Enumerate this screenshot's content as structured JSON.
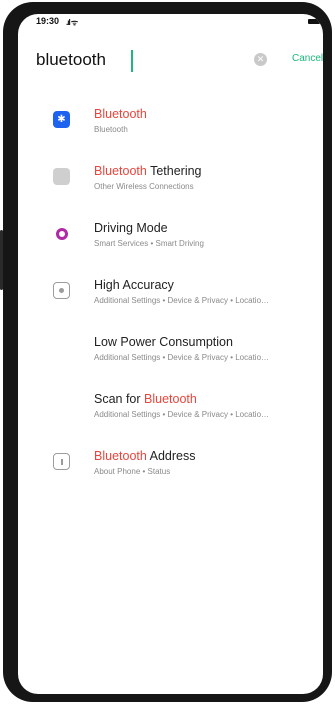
{
  "status_bar": {
    "time": "19:30",
    "signal": ".ıl ᯤ"
  },
  "search": {
    "value": "bluetooth",
    "clear_glyph": "✕",
    "cancel_label": "Cancel"
  },
  "results": [
    {
      "title_prefix": "",
      "title_highlight": "Bluetooth",
      "title_suffix": "",
      "subtitle": "Bluetooth",
      "icon": "bluetooth-icon",
      "icon_glyph": "✱"
    },
    {
      "title_prefix": "",
      "title_highlight": "Bluetooth",
      "title_suffix": " Tethering",
      "subtitle": "Other Wireless Connections",
      "icon": "tethering-icon"
    },
    {
      "title_prefix": "Driving Mode",
      "title_highlight": "",
      "title_suffix": "",
      "subtitle": "Smart Services • Smart Driving",
      "icon": "driving-mode-icon"
    },
    {
      "title_prefix": "High Accuracy",
      "title_highlight": "",
      "title_suffix": "",
      "subtitle": "Additional Settings • Device & Privacy • Locatio…",
      "icon": "location-icon"
    },
    {
      "title_prefix": "Low Power Consumption",
      "title_highlight": "",
      "title_suffix": "",
      "subtitle": "Additional Settings • Device & Privacy • Locatio…",
      "icon": ""
    },
    {
      "title_prefix": "Scan for ",
      "title_highlight": "Bluetooth",
      "title_suffix": "",
      "subtitle": "Additional Settings • Device & Privacy • Locatio…",
      "icon": ""
    },
    {
      "title_prefix": "",
      "title_highlight": "Bluetooth",
      "title_suffix": " Address",
      "subtitle": "About Phone • Status",
      "icon": "info-icon"
    }
  ],
  "colors": {
    "accent": "#1bb87a",
    "highlight": "#e8453c",
    "bluetooth_icon": "#1e63f0",
    "driving_icon": "#b02aa7"
  }
}
